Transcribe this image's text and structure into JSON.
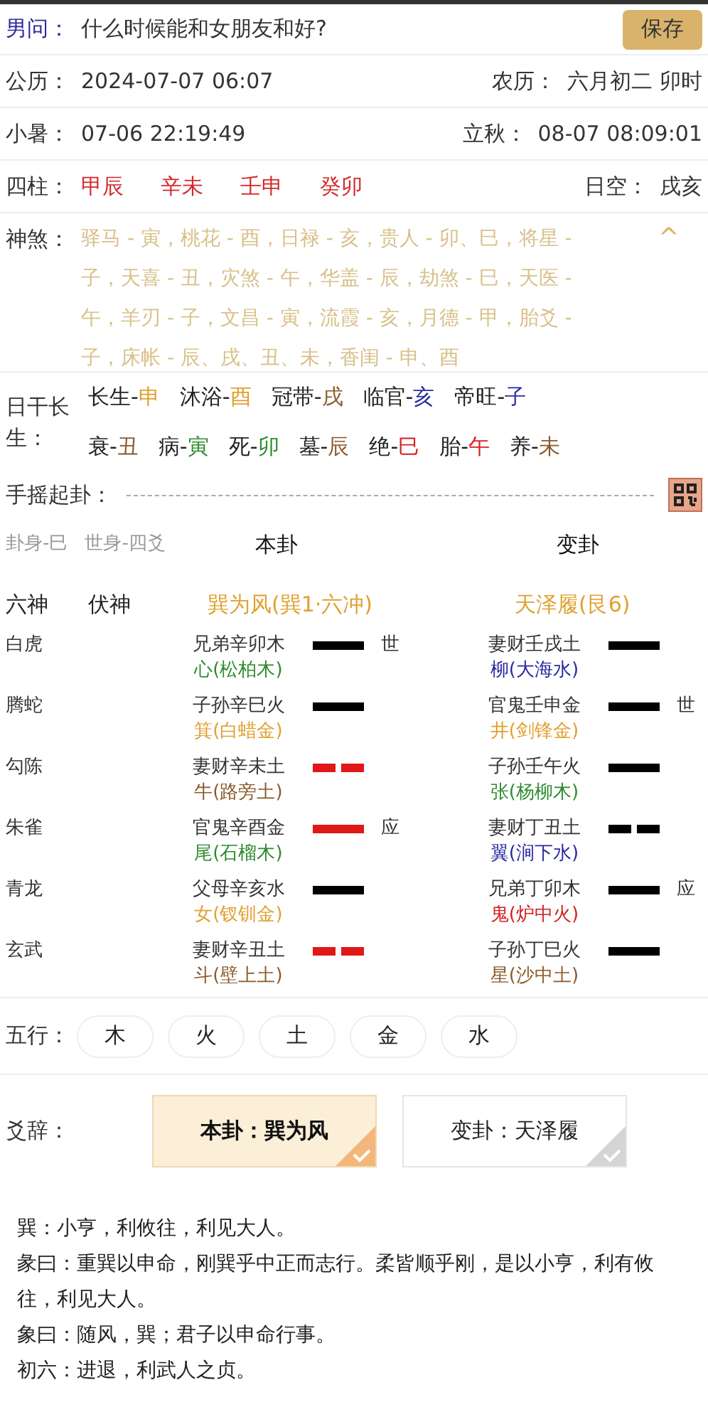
{
  "question": {
    "label": "男问：",
    "text": "什么时候能和女朋友和好?",
    "save": "保存"
  },
  "solar": {
    "label": "公历：",
    "value": "2024-07-07 06:07",
    "lunar_label": "农历：",
    "lunar_value": "六月初二 卯时"
  },
  "terms": {
    "label": "小暑：",
    "value": "07-06 22:19:49",
    "next_label": "立秋：",
    "next_value": "08-07 08:09:01"
  },
  "pillars": {
    "label": "四柱：",
    "items": [
      "甲辰",
      "辛未",
      "壬申",
      "癸卯"
    ],
    "void_label": "日空：",
    "void_value": "戌亥"
  },
  "shensha": {
    "label": "神煞：",
    "text": "驿马 - 寅，桃花 - 酉，日禄 - 亥，贵人 - 卯、巳，将星 - 子，天喜 - 丑，灾煞 - 午，华盖 - 辰，劫煞 - 巳，天医 - 午，羊刃 - 子，文昌 - 寅，流霞 - 亥，月德 - 甲，胎爻 - 子，床帐 - 辰、戌、丑、未，香闺 - 申、酉",
    "expanded": true,
    "toggle": "^"
  },
  "changsheng": {
    "label": "日干长生：",
    "first_line": [
      {
        "name": "长生-",
        "branch": "申",
        "color": "#e0a030"
      },
      {
        "name": "沐浴-",
        "branch": "酉",
        "color": "#e0a030"
      },
      {
        "name": "冠带-",
        "branch": "戌",
        "color": "#8b5a2b"
      },
      {
        "name": "临官-",
        "branch": "亥",
        "color": "#2a2aa0"
      },
      {
        "name": "帝旺-",
        "branch": "子",
        "color": "#2a2aa0"
      }
    ],
    "second_line": [
      {
        "name": "衰-",
        "branch": "丑",
        "color": "#8b5a2b"
      },
      {
        "name": "病-",
        "branch": "寅",
        "color": "#2e8b2e"
      },
      {
        "name": "死-",
        "branch": "卯",
        "color": "#2e8b2e"
      },
      {
        "name": "墓-",
        "branch": "辰",
        "color": "#8b5a2b"
      },
      {
        "name": "绝-",
        "branch": "巳",
        "color": "#d42020"
      },
      {
        "name": "胎-",
        "branch": "午",
        "color": "#d42020"
      },
      {
        "name": "养-",
        "branch": "未",
        "color": "#8b5a2b"
      }
    ]
  },
  "shake": {
    "label": "手摇起卦："
  },
  "gua": {
    "gua_body": "卦身-巳",
    "shi_body": "世身-四爻",
    "ben_title": "本卦",
    "bian_title": "变卦",
    "col_liushen": "六神",
    "col_fushen": "伏神",
    "ben_name": "巽为风(巽1·六冲)",
    "bian_name": "天泽履(艮6)"
  },
  "yao": [
    {
      "liushen": "白虎",
      "ben": {
        "text": "兄弟辛卯木",
        "nayin": "心(松柏木)",
        "color": "#2e8b2e",
        "kind": "yang",
        "moving": false,
        "mark": "世"
      },
      "bian": {
        "text": "妻财壬戌土",
        "nayin": "柳(大海水)",
        "color": "#2a2aa0",
        "kind": "yang"
      }
    },
    {
      "liushen": "腾蛇",
      "ben": {
        "text": "子孙辛巳火",
        "nayin": "箕(白蜡金)",
        "color": "#e0a030",
        "kind": "yang",
        "moving": false
      },
      "bian": {
        "text": "官鬼壬申金",
        "nayin": "井(剑锋金)",
        "color": "#e0a030",
        "kind": "yang",
        "mark": "世"
      }
    },
    {
      "liushen": "勾陈",
      "ben": {
        "text": "妻财辛未土",
        "nayin": "牛(路旁土)",
        "color": "#8b5a2b",
        "kind": "yin",
        "moving": true
      },
      "bian": {
        "text": "子孙壬午火",
        "nayin": "张(杨柳木)",
        "color": "#2e8b2e",
        "kind": "yang"
      }
    },
    {
      "liushen": "朱雀",
      "ben": {
        "text": "官鬼辛酉金",
        "nayin": "尾(石榴木)",
        "color": "#2e8b2e",
        "kind": "yang",
        "moving": true,
        "mark": "应"
      },
      "bian": {
        "text": "妻财丁丑土",
        "nayin": "翼(涧下水)",
        "color": "#2a2aa0",
        "kind": "yin"
      }
    },
    {
      "liushen": "青龙",
      "ben": {
        "text": "父母辛亥水",
        "nayin": "女(钗钏金)",
        "color": "#e0a030",
        "kind": "yang",
        "moving": false
      },
      "bian": {
        "text": "兄弟丁卯木",
        "nayin": "鬼(炉中火)",
        "color": "#d42020",
        "kind": "yang",
        "mark": "应"
      }
    },
    {
      "liushen": "玄武",
      "ben": {
        "text": "妻财辛丑土",
        "nayin": "斗(壁上土)",
        "color": "#8b5a2b",
        "kind": "yin",
        "moving": true
      },
      "bian": {
        "text": "子孙丁巳火",
        "nayin": "星(沙中土)",
        "color": "#8b5a2b",
        "kind": "yang"
      }
    }
  ],
  "wuxing": {
    "label": "五行：",
    "items": [
      "木",
      "火",
      "土",
      "金",
      "水"
    ]
  },
  "yaoci": {
    "label": "爻辞：",
    "tabs": [
      {
        "label": "本卦：巽为风",
        "selected": true
      },
      {
        "label": "变卦：天泽履",
        "selected": false
      }
    ]
  },
  "text": [
    "巽：小亨，利攸往，利见大人。",
    "彖曰：重巽以申命，刚巽乎中正而志行。柔皆顺乎刚，是以小亨，利有攸往，利见大人。",
    "象曰：随风，巽；君子以申命行事。",
    "初六：进退，利武人之贞。"
  ]
}
